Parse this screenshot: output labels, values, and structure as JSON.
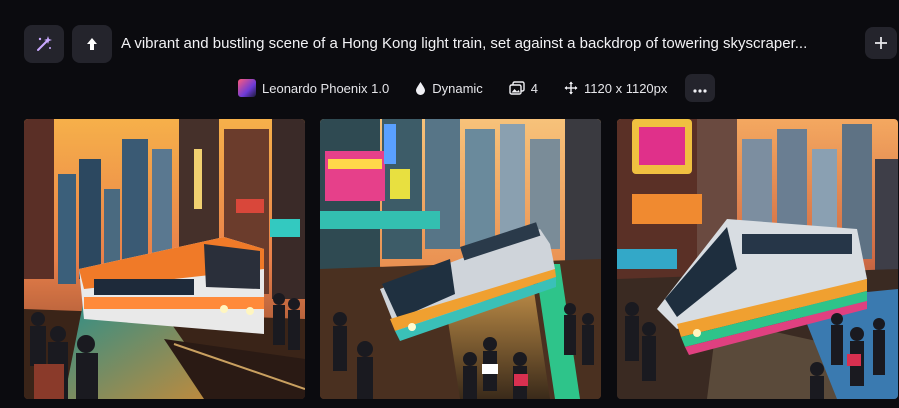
{
  "toolbar": {
    "magic_icon": "magic-wand-icon",
    "upload_icon": "arrow-up-icon",
    "add_icon": "plus-icon"
  },
  "prompt": {
    "text": "A vibrant and bustling scene of a Hong Kong light train, set against a backdrop of towering skyscraper..."
  },
  "meta": {
    "model": "Leonardo Phoenix 1.0",
    "style": "Dynamic",
    "count": "4",
    "size": "1120 x 1120px",
    "more_icon": "more-dots-icon"
  },
  "images": [
    {
      "name": "generated-image-1",
      "scene": "orange-train"
    },
    {
      "name": "generated-image-2",
      "scene": "silver-train"
    },
    {
      "name": "generated-image-3",
      "scene": "colorful-train"
    }
  ],
  "colors": {
    "background": "#0b0b0f",
    "button_bg": "#24242c",
    "text": "#f2f2f5"
  }
}
